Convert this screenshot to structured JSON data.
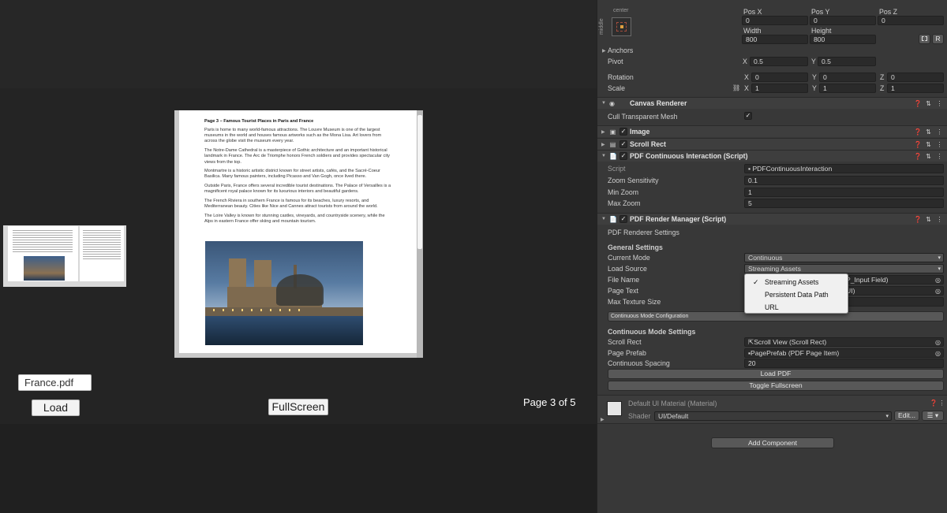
{
  "game": {
    "file_input_value": "France.pdf",
    "load_button": "Load",
    "fullscreen_button": "FullScreen",
    "page_indicator": "Page 3 of 5",
    "document": {
      "title": "Page 3 – Famous Tourist Places in Paris and France",
      "paragraphs": [
        "Paris is home to many world-famous attractions. The Louvre Museum is one of the largest museums in the world and houses famous artworks such as the Mona Lisa. Art lovers from across the globe visit the museum every year.",
        "The Notre-Dame Cathedral is a masterpiece of Gothic architecture and an important historical landmark in France. The Arc de Triomphe honors French soldiers and provides spectacular city views from the top.",
        "Montmartre is a historic artistic district known for street artists, cafés, and the Sacré-Coeur Basilica. Many famous painters, including Picasso and Van Gogh, once lived there.",
        "Outside Paris, France offers several incredible tourist destinations. The Palace of Versailles is a magnificent royal palace known for its luxurious interiors and beautiful gardens.",
        "The French Riviera in southern France is famous for its beaches, luxury resorts, and Mediterranean beauty. Cities like Nice and Cannes attract tourists from around the world.",
        "The Loire Valley is known for stunning castles, vineyards, and countryside scenery, while the Alps in eastern France offer skiing and mountain tourism."
      ]
    }
  },
  "inspector": {
    "rect": {
      "anchor_h": "center",
      "anchor_v": "middle",
      "pos_x_label": "Pos X",
      "pos_y_label": "Pos Y",
      "pos_z_label": "Pos Z",
      "pos_x": "0",
      "pos_y": "0",
      "pos_z": "0",
      "width_label": "Width",
      "height_label": "Height",
      "width": "800",
      "height": "800",
      "r_button": "R",
      "anchors_label": "Anchors",
      "pivot_label": "Pivot",
      "pivot_x": "0.5",
      "pivot_y": "0.5",
      "rotation_label": "Rotation",
      "rot_x": "0",
      "rot_y": "0",
      "rot_z": "0",
      "scale_label": "Scale",
      "scale_x": "1",
      "scale_y": "1",
      "scale_z": "1",
      "x": "X",
      "y": "Y",
      "z": "Z"
    },
    "canvas_renderer": {
      "title": "Canvas Renderer",
      "cull_label": "Cull Transparent Mesh"
    },
    "image": {
      "title": "Image"
    },
    "scroll_rect": {
      "title": "Scroll Rect"
    },
    "pdf_interaction": {
      "title": "PDF Continuous Interaction (Script)",
      "script_label": "Script",
      "script_value": "PDFContinuousInteraction",
      "zoom_sensitivity_label": "Zoom Sensitivity",
      "zoom_sensitivity": "0.1",
      "min_zoom_label": "Min Zoom",
      "min_zoom": "1",
      "max_zoom_label": "Max Zoom",
      "max_zoom": "5"
    },
    "pdf_render": {
      "title": "PDF Render Manager (Script)",
      "renderer_settings": "PDF Renderer Settings",
      "general_settings": "General Settings",
      "current_mode_label": "Current Mode",
      "current_mode": "Continuous",
      "load_source_label": "Load Source",
      "load_source": "Streaming Assets",
      "file_name_label": "File Name",
      "file_name_partial": "P_Input Field)",
      "page_text_label": "Page Text",
      "page_text_partial": "UI)",
      "max_texture_label": "Max Texture Size",
      "continuous_config_button": "Continuous Mode Configuration",
      "continuous_settings": "Continuous Mode Settings",
      "scroll_rect_label": "Scroll Rect",
      "scroll_rect_value": "Scroll View (Scroll Rect)",
      "page_prefab_label": "Page Prefab",
      "page_prefab_value": "PagePrefab (PDF Page Item)",
      "spacing_label": "Continuous Spacing",
      "spacing": "20",
      "load_pdf_button": "Load PDF",
      "toggle_fullscreen_button": "Toggle Fullscreen"
    },
    "load_source_menu": {
      "options": [
        "Streaming Assets",
        "Persistent Data Path",
        "URL"
      ],
      "selected": "Streaming Assets"
    },
    "material": {
      "title": "Default UI Material (Material)",
      "shader_label": "Shader",
      "shader_value": "UI/Default",
      "edit_button": "Edit..."
    },
    "add_component_button": "Add Component"
  }
}
